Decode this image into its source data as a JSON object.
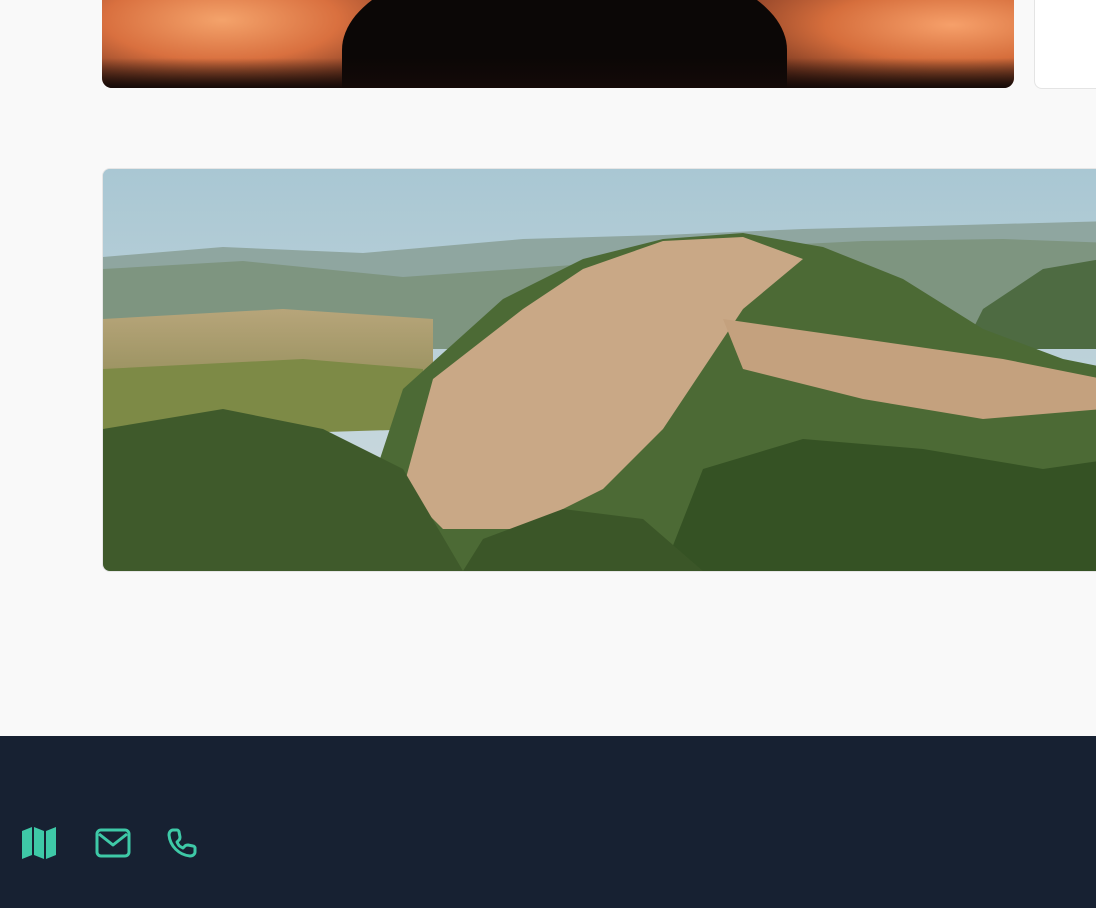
{
  "images": {
    "top_image": "sunset-silhouette-photo",
    "panorama_image": "hilltop-village-panorama-photo"
  },
  "footer": {
    "icons": [
      {
        "name": "map-icon"
      },
      {
        "name": "envelope-icon"
      },
      {
        "name": "phone-icon"
      }
    ],
    "icon_color": "#3ec9a7",
    "background_color": "#172132"
  },
  "colors": {
    "page_background": "#f9f9f9"
  }
}
